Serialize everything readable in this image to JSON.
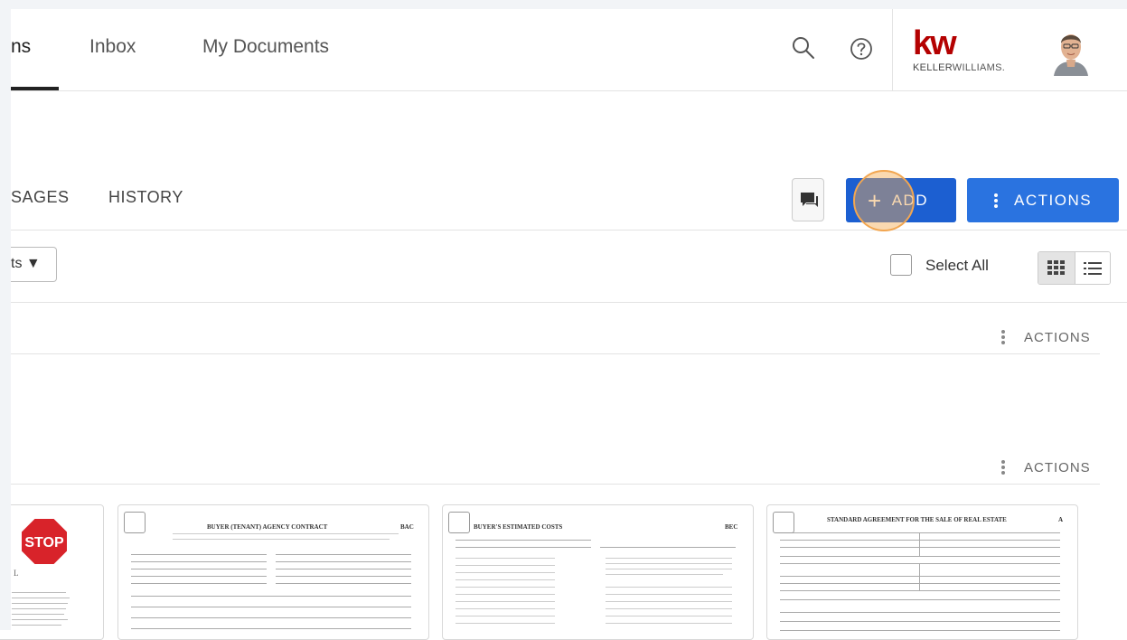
{
  "nav": {
    "tabs": [
      {
        "label": "ns",
        "active": true
      },
      {
        "label": "Inbox",
        "active": false
      },
      {
        "label": "My Documents",
        "active": false
      }
    ]
  },
  "header": {
    "search_icon": "search-icon",
    "help_icon": "help-icon",
    "logo_mark": "kw",
    "logo_word_bold": "KELLER",
    "logo_word_light": "WILLIAMS.",
    "avatar": "user-avatar",
    "brand_color": "#b40101"
  },
  "subtabs": [
    {
      "label": "SAGES"
    },
    {
      "label": "HISTORY"
    }
  ],
  "toolbar": {
    "chat_icon": "chat-icon",
    "add_label": "ADD",
    "add_plus": "+",
    "actions_label": "ACTIONS",
    "accent": "#2a73e0"
  },
  "filter": {
    "selected": "ts ▼"
  },
  "select_all": {
    "label": "Select All",
    "checked": false
  },
  "view": {
    "grid_icon": "grid-view-icon",
    "list_icon": "list-view-icon",
    "active": "grid"
  },
  "sections": [
    {
      "actions_label": "ACTIONS"
    },
    {
      "actions_label": "ACTIONS"
    }
  ],
  "documents": [
    {
      "title": "",
      "stop_label": "STOP"
    },
    {
      "title": "BUYER (TENANT) AGENCY CONTRACT",
      "code": "BAC"
    },
    {
      "title": "BUYER'S ESTIMATED COSTS",
      "code": "BEC"
    },
    {
      "title": "STANDARD AGREEMENT FOR THE SALE OF REAL ESTATE",
      "code": "A"
    }
  ]
}
